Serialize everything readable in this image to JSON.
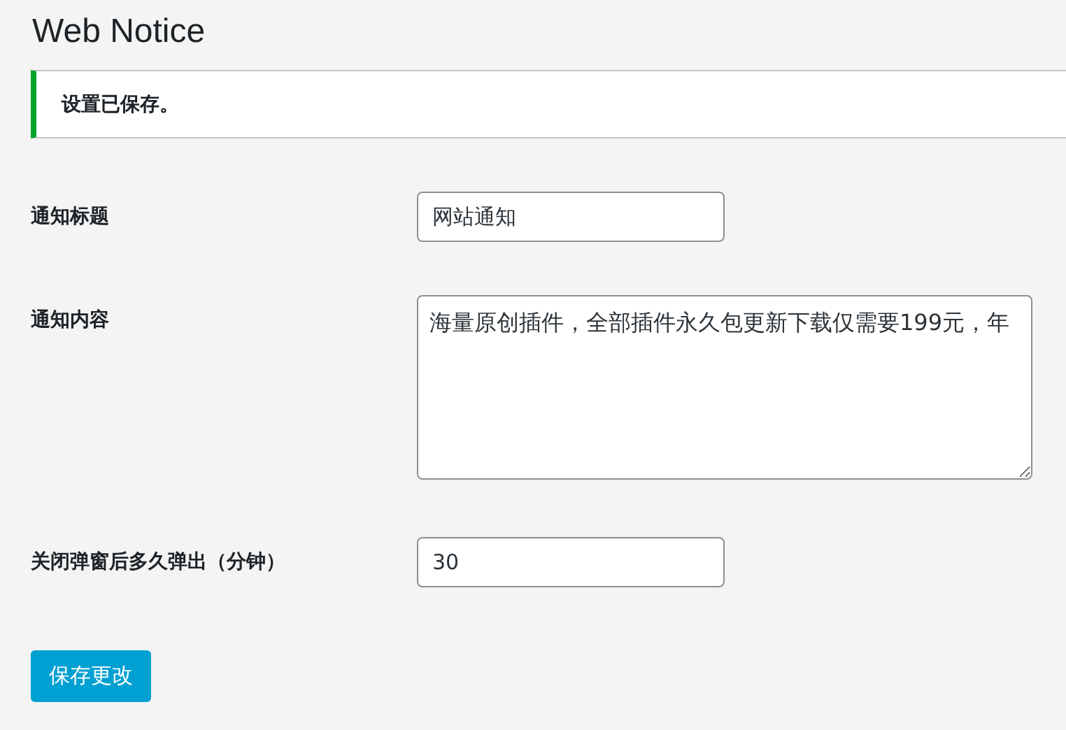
{
  "page_title": "Web Notice",
  "notice": {
    "text": "设置已保存。"
  },
  "fields": [
    {
      "kind": "input",
      "label": "通知标题",
      "value": "网站通知"
    },
    {
      "kind": "textarea",
      "label": "通知内容",
      "value": "海量原创插件，全部插件永久包更新下载仅需要199元，年"
    },
    {
      "kind": "input",
      "label": "关闭弹窗后多久弹出（分钟）",
      "value": "30"
    }
  ],
  "save_button": "保存更改"
}
